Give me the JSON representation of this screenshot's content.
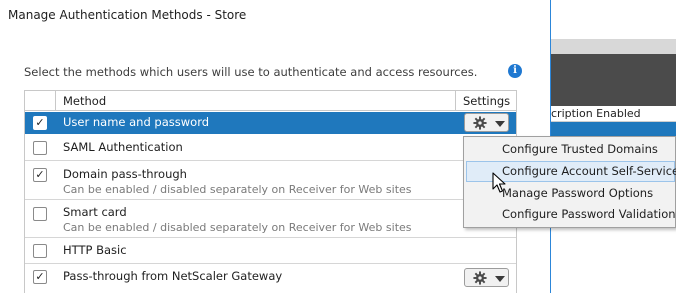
{
  "dialog": {
    "title": "Manage Authentication Methods - Store",
    "instruction": "Select the methods which users will use to authenticate and access resources."
  },
  "table": {
    "columns": {
      "method": "Method",
      "settings": "Settings"
    },
    "rows": [
      {
        "label": "User name and password",
        "checked": true,
        "selected": true,
        "has_settings": true
      },
      {
        "label": "SAML Authentication",
        "checked": false
      },
      {
        "label": "Domain pass-through",
        "sub": "Can be enabled / disabled separately on Receiver for Web sites",
        "checked": true
      },
      {
        "label": "Smart card",
        "sub": "Can be enabled / disabled separately on Receiver for Web sites",
        "checked": false
      },
      {
        "label": "HTTP Basic",
        "checked": false
      },
      {
        "label": "Pass-through from NetScaler Gateway",
        "checked": true,
        "has_settings": true
      }
    ]
  },
  "context_menu": {
    "items": [
      {
        "label": "Configure Trusted Domains"
      },
      {
        "label": "Configure Account Self-Service",
        "hovered": true
      },
      {
        "label": "Manage Password Options"
      },
      {
        "label": "Configure Password Validation"
      }
    ]
  },
  "background_app": {
    "column_header": "cription Enabled"
  },
  "colors": {
    "selection": "#1f78bd",
    "info": "#1f78d1",
    "dialog_border": "#2c86d9",
    "menu_hover": "#e0ecf8"
  },
  "icons": {
    "info": "info-icon",
    "settings": "gear-icon",
    "dropdown": "caret-down-icon",
    "check": "checkmark-icon",
    "cursor": "mouse-pointer-icon"
  }
}
